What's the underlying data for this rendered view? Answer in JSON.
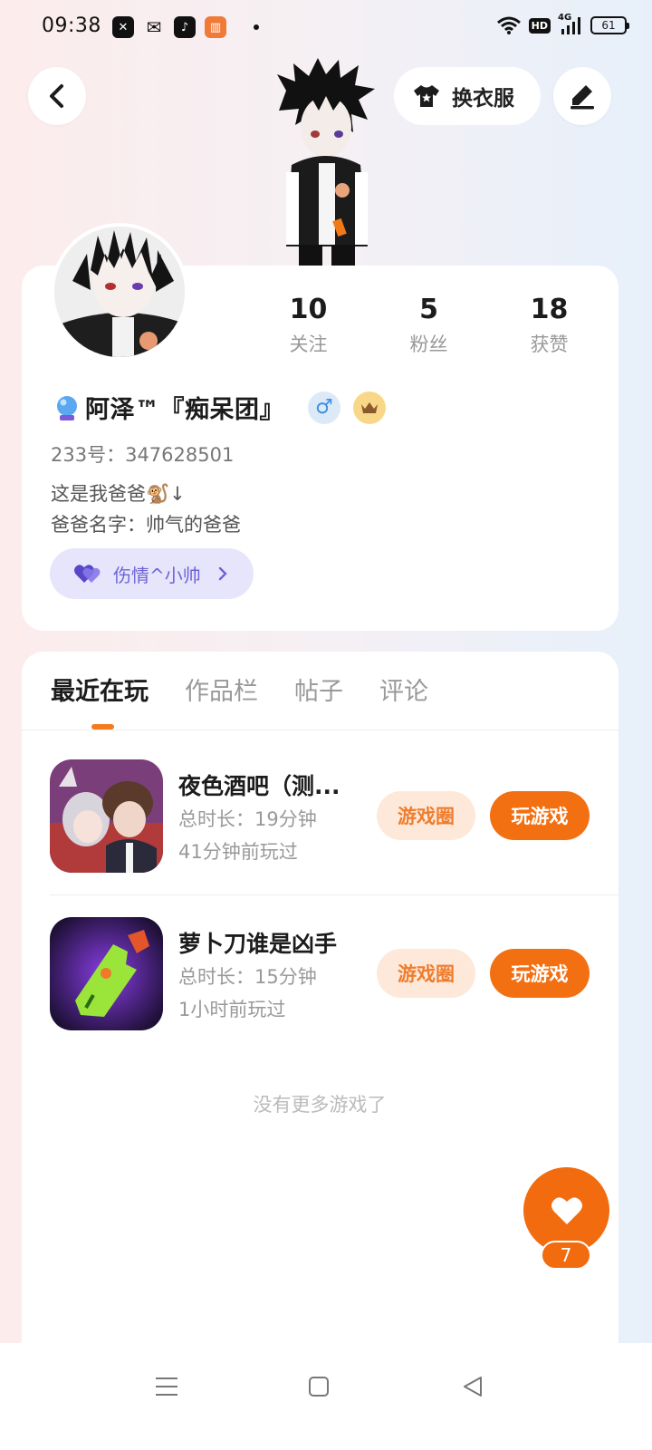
{
  "status_bar": {
    "time": "09:38",
    "apps": [
      "capcut-icon",
      "wechat-icon",
      "tiktok-icon",
      "book-icon"
    ],
    "hd": "HD",
    "network": "4G",
    "battery": "61"
  },
  "header": {
    "dress_label": "换衣服"
  },
  "profile": {
    "stats": [
      {
        "value": "10",
        "label": "关注"
      },
      {
        "value": "5",
        "label": "粉丝"
      },
      {
        "value": "18",
        "label": "获赞"
      }
    ],
    "name": "阿泽™『痴呆团』",
    "gender": "♂",
    "uid": "233号：347628501",
    "bio_line1": "这是我爸爸🐒↓",
    "bio_line2": "爸爸名字：帅气的爸爸",
    "group_label": "伤情^小帅",
    "accent_color": "#f37012"
  },
  "tabs": [
    "最近在玩",
    "作品栏",
    "帖子",
    "评论"
  ],
  "games": [
    {
      "title": "夜色酒吧（测...",
      "duration": "总时长：19分钟",
      "last_played": "41分钟前玩过",
      "circle_label": "游戏圈",
      "play_label": "玩游戏"
    },
    {
      "title": "萝卜刀谁是凶手",
      "duration": "总时长：15分钟",
      "last_played": "1小时前玩过",
      "circle_label": "游戏圈",
      "play_label": "玩游戏"
    }
  ],
  "footer_text": "没有更多游戏了",
  "like": {
    "count": "7"
  }
}
